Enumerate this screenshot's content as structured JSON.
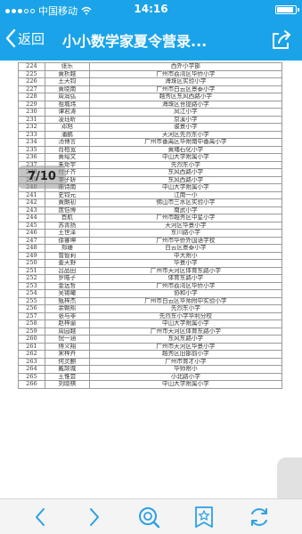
{
  "status_bar": {
    "carrier": "中国移动",
    "time": "14:16",
    "battery_level": 0.9
  },
  "nav": {
    "back_label": "返回",
    "title": "小小数学家夏令营录..."
  },
  "page_indicator": "7/10",
  "table": {
    "rows": [
      {
        "no": "224",
        "name": "张乐",
        "school": "西外小学部"
      },
      {
        "no": "225",
        "name": "黄析越",
        "school": "广州市荔湾区华侨小学"
      },
      {
        "no": "226",
        "name": "王天钧",
        "school": "海珠区实验小学"
      },
      {
        "no": "227",
        "name": "黄晓南",
        "school": "广州市白云区景泰小学"
      },
      {
        "no": "228",
        "name": "周润弘",
        "school": "越秀区东风西路小学"
      },
      {
        "no": "229",
        "name": "祖城玮",
        "school": "海珠区菩提路小学"
      },
      {
        "no": "230",
        "name": "谭君涛",
        "school": "凤江小学"
      },
      {
        "no": "231",
        "name": "凌珏昕",
        "school": "京溪小学"
      },
      {
        "no": "232",
        "name": "邓旭",
        "school": "骏景小学"
      },
      {
        "no": "233",
        "name": "潘鹏",
        "school": "天河区先烈东小学"
      },
      {
        "no": "234",
        "name": "汤博言",
        "school": "广州市番禺区华附南中番禺小学"
      },
      {
        "no": "235",
        "name": "肖柏宽",
        "school": "黄埔石化小学"
      },
      {
        "no": "236",
        "name": "黄绍文",
        "school": "中山大学附属小学"
      },
      {
        "no": "237",
        "name": "朱炬宇",
        "school": "先烈东小学"
      },
      {
        "no": "238",
        "name": "付子齐",
        "school": "东风西路小学"
      },
      {
        "no": "239",
        "name": "李子妍",
        "school": "东风西路小学"
      },
      {
        "no": "240",
        "name": "陈诗南",
        "school": "中山大学附属小学"
      },
      {
        "no": "241",
        "name": "史钧元",
        "school": "江南一小"
      },
      {
        "no": "242",
        "name": "黄朗初",
        "school": "佛山市三水区实验小学"
      },
      {
        "no": "243",
        "name": "庞恺博",
        "school": "南武小学"
      },
      {
        "no": "244",
        "name": "首航",
        "school": "广州市越秀区中星小学"
      },
      {
        "no": "245",
        "name": "苏青扬",
        "school": "天河区华景小学"
      },
      {
        "no": "246",
        "name": "王世泽",
        "school": "东川路小学"
      },
      {
        "no": "247",
        "name": "徐睿坤",
        "school": "广州市华侨外国语学校"
      },
      {
        "no": "248",
        "name": "郑珊",
        "school": "白云区景泰小学"
      },
      {
        "no": "249",
        "name": "曾智莉",
        "school": "中大附小"
      },
      {
        "no": "250",
        "name": "姜天野",
        "school": "华景小学"
      },
      {
        "no": "251",
        "name": "吕品田",
        "school": "广州市天河区体育东路小学"
      },
      {
        "no": "252",
        "name": "罗皓子",
        "school": "体育东路小学"
      },
      {
        "no": "253",
        "name": "金远哲",
        "school": "广州市荔湾区华侨小学"
      },
      {
        "no": "254",
        "name": "吴锡瞰",
        "school": "协和小学"
      },
      {
        "no": "255",
        "name": "甄梓杰",
        "school": "广州市白云区华师附中实验小学"
      },
      {
        "no": "256",
        "name": "余朝熙",
        "school": "先烈东小学"
      },
      {
        "no": "257",
        "name": "张与非",
        "school": "先烈东小学华利分校"
      },
      {
        "no": "258",
        "name": "赵梓谕",
        "school": "中山大学附属小学"
      },
      {
        "no": "259",
        "name": "周园越",
        "school": "广州市天河区体育东路小学"
      },
      {
        "no": "260",
        "name": "倪一涵",
        "school": "东风东路小学"
      },
      {
        "no": "261",
        "name": "傅义翔",
        "school": "广州市天河区华景小学"
      },
      {
        "no": "262",
        "name": "宋梓卉",
        "school": "越秀区旧部前小学"
      },
      {
        "no": "263",
        "name": "何灵麒",
        "school": "广州市育才小学"
      },
      {
        "no": "264",
        "name": "戴颉城",
        "school": "华师附小"
      },
      {
        "no": "265",
        "name": "王惟尝",
        "school": "小北路小学"
      },
      {
        "no": "266",
        "name": "刘晓棋",
        "school": "中山大学附属小学"
      }
    ]
  },
  "toolbar": {
    "icons": [
      "back-arrow-icon",
      "forward-arrow-icon",
      "search-icon",
      "bookmark-star-icon",
      "refresh-icon"
    ]
  },
  "colors": {
    "accent": "#1aa3e8",
    "toolbar_icon": "#2aa0e6"
  }
}
